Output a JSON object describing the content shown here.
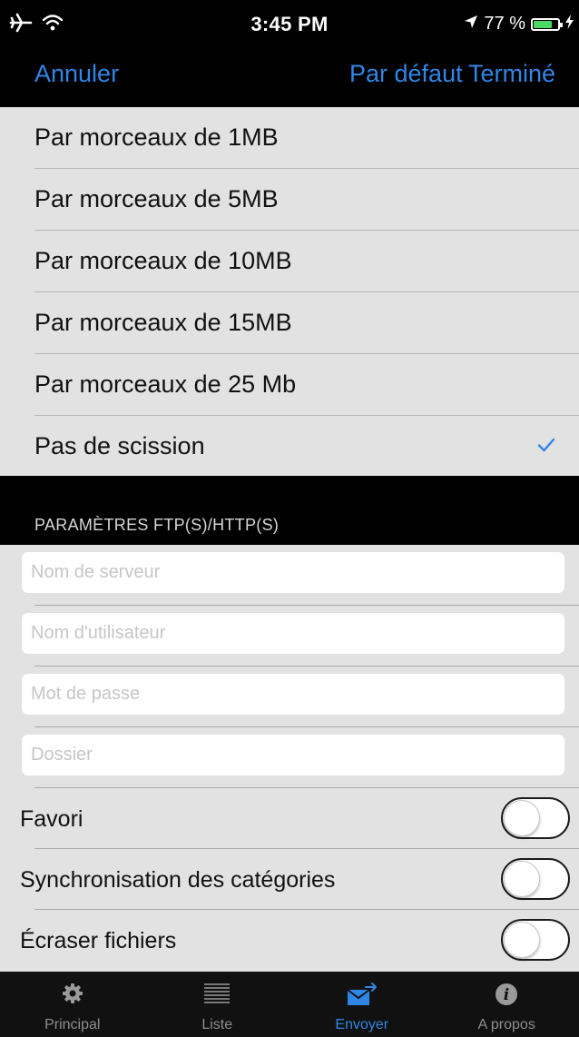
{
  "status_bar": {
    "time": "3:45 PM",
    "battery_text": "77 %",
    "battery_level": 0.77,
    "icons": [
      "airplane-icon",
      "wifi-icon",
      "location-arrow-icon",
      "battery-icon",
      "charging-bolt-icon"
    ]
  },
  "nav": {
    "cancel_label": "Annuler",
    "default_label": "Par défaut",
    "done_label": "Terminé",
    "accent_color": "#2f86e6"
  },
  "options": {
    "items": [
      {
        "label": "Par morceaux de 1MB",
        "selected": false
      },
      {
        "label": "Par morceaux de 5MB",
        "selected": false
      },
      {
        "label": "Par morceaux de 10MB",
        "selected": false
      },
      {
        "label": "Par morceaux de 15MB",
        "selected": false
      },
      {
        "label": "Par morceaux de 25 Mb",
        "selected": false
      },
      {
        "label": "Pas de scission",
        "selected": true
      }
    ]
  },
  "settings": {
    "header": "PARAMÈTRES FTP(S)/HTTP(S)",
    "fields": [
      {
        "placeholder": "Nom de serveur",
        "value": ""
      },
      {
        "placeholder": "Nom d'utilisateur",
        "value": ""
      },
      {
        "placeholder": "Mot de passe",
        "value": ""
      },
      {
        "placeholder": "Dossier",
        "value": ""
      }
    ],
    "toggles": [
      {
        "label": "Favori",
        "on": false
      },
      {
        "label": "Synchronisation des catégories",
        "on": false
      },
      {
        "label": "Écraser fichiers",
        "on": false
      }
    ]
  },
  "tabs": {
    "items": [
      {
        "label": "Principal",
        "icon": "gear-icon",
        "active": false
      },
      {
        "label": "Liste",
        "icon": "list-icon",
        "active": false
      },
      {
        "label": "Envoyer",
        "icon": "send-mail-icon",
        "active": true
      },
      {
        "label": "A propos",
        "icon": "info-icon",
        "active": false
      }
    ],
    "active_color": "#2f86e6",
    "inactive_color": "#8e8e8e"
  }
}
